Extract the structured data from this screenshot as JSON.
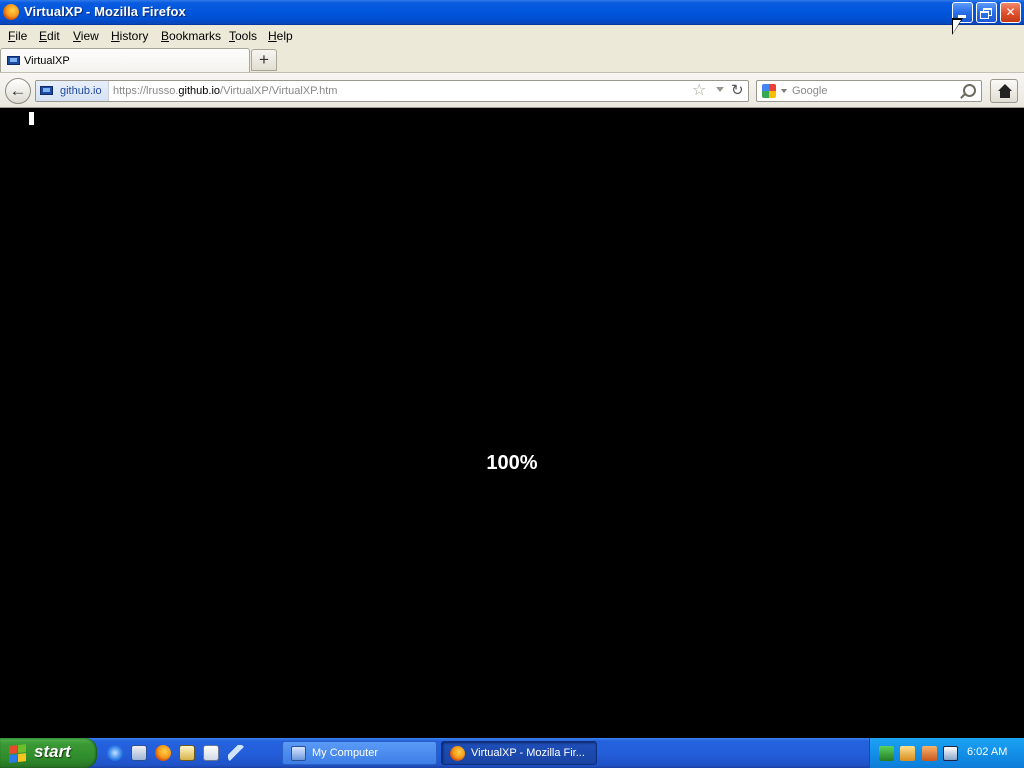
{
  "window": {
    "title": "VirtualXP - Mozilla Firefox",
    "icon": "firefox-icon",
    "controls": [
      "minimize",
      "restore",
      "close"
    ]
  },
  "menubar": {
    "items": [
      "File",
      "Edit",
      "View",
      "History",
      "Bookmarks",
      "Tools",
      "Help"
    ]
  },
  "tabs": [
    {
      "label": "VirtualXP",
      "icon": "site-monitor-icon",
      "active": true
    }
  ],
  "navbar": {
    "identity_domain": "github.io",
    "url_prefix": "https://lrusso.",
    "url_host": "github.io",
    "url_path": "/VirtualXP/VirtualXP.htm",
    "search_placeholder": "Google",
    "search_engine_icon": "google-icon"
  },
  "content": {
    "background": "#000000",
    "progress_text": "100%"
  },
  "taskbar": {
    "start_label": "start",
    "quick_launch": [
      "ie-icon",
      "show-desktop-icon",
      "firefox-icon",
      "notes-icon",
      "search-icon",
      "plane-icon"
    ],
    "tasks": [
      {
        "label": "My Computer",
        "icon": "my-computer-icon",
        "active": false
      },
      {
        "label": "VirtualXP - Mozilla Fir...",
        "icon": "firefox-icon",
        "active": true
      }
    ],
    "tray_icons": [
      "network-icon",
      "tray-app-icon",
      "tray-media-icon",
      "tray-calendar-icon"
    ],
    "clock": "6:02 AM"
  },
  "colors": {
    "xp_blue": "#0056dc",
    "start_green": "#3a9a35",
    "tray_blue": "#1290e8",
    "menu_bg": "#ece9d8"
  }
}
